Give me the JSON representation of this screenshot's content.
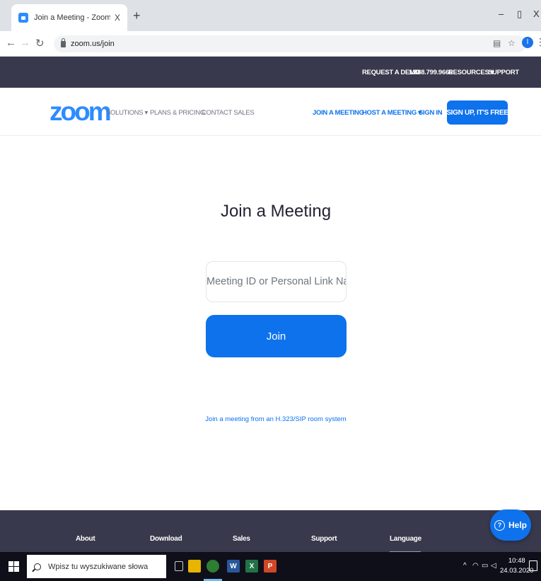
{
  "browser": {
    "tab_title": "Join a Meeting - Zoom",
    "tab_close": "X",
    "new_tab": "+",
    "url": "zoom.us/join",
    "profile_initial": "I",
    "minimize": "–",
    "restore": "▯",
    "close": "X"
  },
  "topbar": {
    "request_demo": "REQUEST A DEMO",
    "phone": "1.888.799.9666",
    "resources": "RESOURCES ▾",
    "support": "SUPPORT"
  },
  "navbar": {
    "logo": "zoom",
    "solutions": "SOLUTIONS ▾",
    "plans_pricing": "PLANS & PRICING",
    "contact_sales": "CONTACT SALES",
    "join_meeting": "JOIN A MEETING",
    "host_meeting": "HOST A MEETING ▾",
    "sign_in": "SIGN IN",
    "sign_up": "SIGN UP, IT'S FREE"
  },
  "main": {
    "title": "Join a Meeting",
    "meeting_id_placeholder": "Meeting ID or Personal Link Name",
    "join_label": "Join",
    "sip_link": "Join a meeting from an H.323/SIP room system"
  },
  "footer": {
    "about": "About",
    "download": "Download",
    "sales": "Sales",
    "support": "Support",
    "language": "Language",
    "help": "Help"
  },
  "taskbar": {
    "search_placeholder": "Wpisz tu wyszukiwane słowa",
    "time": "10:48",
    "date": "24.03.2020"
  },
  "colors": {
    "brand_blue": "#0e72ed",
    "logo_blue": "#2d8cff",
    "dark_bar": "#39394d"
  }
}
